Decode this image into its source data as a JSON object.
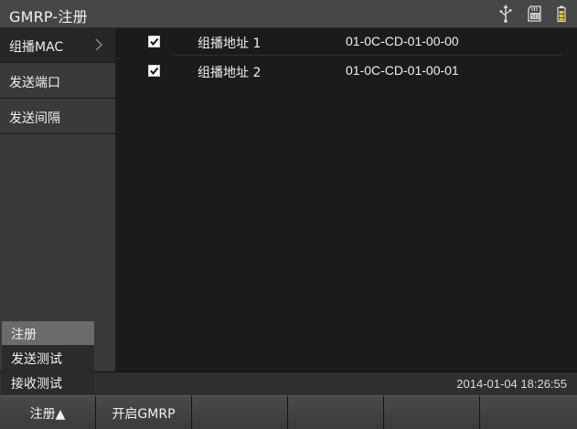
{
  "title": "GMRP-注册",
  "status_icons": [
    "usb-icon",
    "sd-card-icon",
    "battery-icon"
  ],
  "colors": {
    "battery_fill": "#e6d200",
    "checkbox": "#fafafa"
  },
  "left_menu": {
    "items": [
      {
        "label": "组播MAC",
        "active": true
      },
      {
        "label": "发送端口"
      },
      {
        "label": "发送间隔"
      }
    ]
  },
  "addresses": [
    {
      "checked": true,
      "name": "组播地址 1",
      "mac": "01-0C-CD-01-00-00"
    },
    {
      "checked": true,
      "name": "组播地址 2",
      "mac": "01-0C-CD-01-00-01"
    }
  ],
  "datetime": "2014-01-04 18:26:55",
  "popup_menu": {
    "items": [
      "注册",
      "发送测试",
      "接收测试"
    ],
    "selected": "注册"
  },
  "softkeys": [
    "注册▲",
    "开启GMRP",
    "",
    "",
    "",
    ""
  ]
}
